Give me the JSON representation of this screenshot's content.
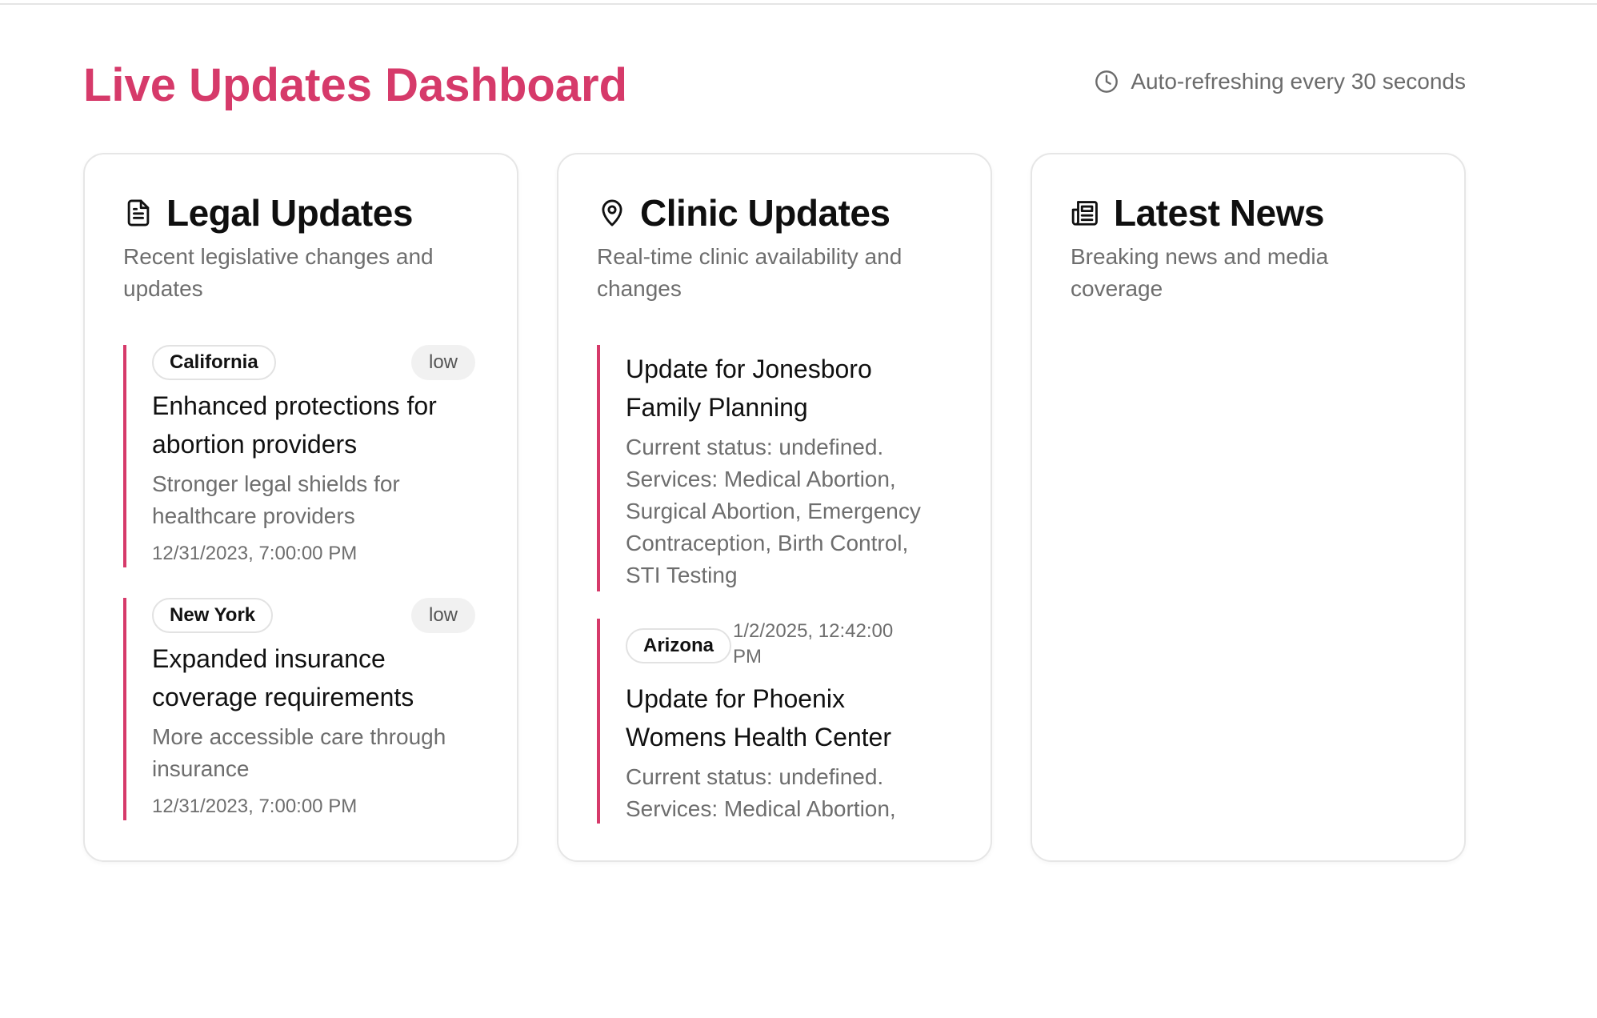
{
  "header": {
    "title": "Live Updates Dashboard",
    "refresh_text": "Auto-refreshing every 30 seconds",
    "refresh_icon": "clock-icon"
  },
  "colors": {
    "accent": "#d63a6a",
    "muted_text": "#6e6e6e",
    "border": "#e6e6e6"
  },
  "cards": [
    {
      "icon": "document-icon",
      "title": "Legal Updates",
      "description": "Recent legislative changes and updates",
      "items": [
        {
          "tag": "California",
          "severity": "low",
          "title": "Enhanced protections for abortion providers",
          "description": "Stronger legal shields for healthcare providers",
          "date": "12/31/2023, 7:00:00 PM"
        },
        {
          "tag": "New York",
          "severity": "low",
          "title": "Expanded insurance coverage requirements",
          "description": "More accessible care through insurance",
          "date": "12/31/2023, 7:00:00 PM"
        }
      ]
    },
    {
      "icon": "map-pin-icon",
      "title": "Clinic Updates",
      "description": "Real-time clinic availability and changes",
      "items": [
        {
          "title": "Update for Jonesboro Family Planning",
          "description": "Current status: undefined. Services: Medical Abortion, Surgical Abortion, Emergency Contraception, Birth Control, STI Testing"
        },
        {
          "tag": "Arizona",
          "date": "1/2/2025, 12:42:00 PM",
          "title": "Update for Phoenix Womens Health Center",
          "description": "Current status: undefined. Services: Medical Abortion,"
        }
      ]
    },
    {
      "icon": "newspaper-icon",
      "title": "Latest News",
      "description": "Breaking news and media coverage",
      "items": []
    }
  ]
}
